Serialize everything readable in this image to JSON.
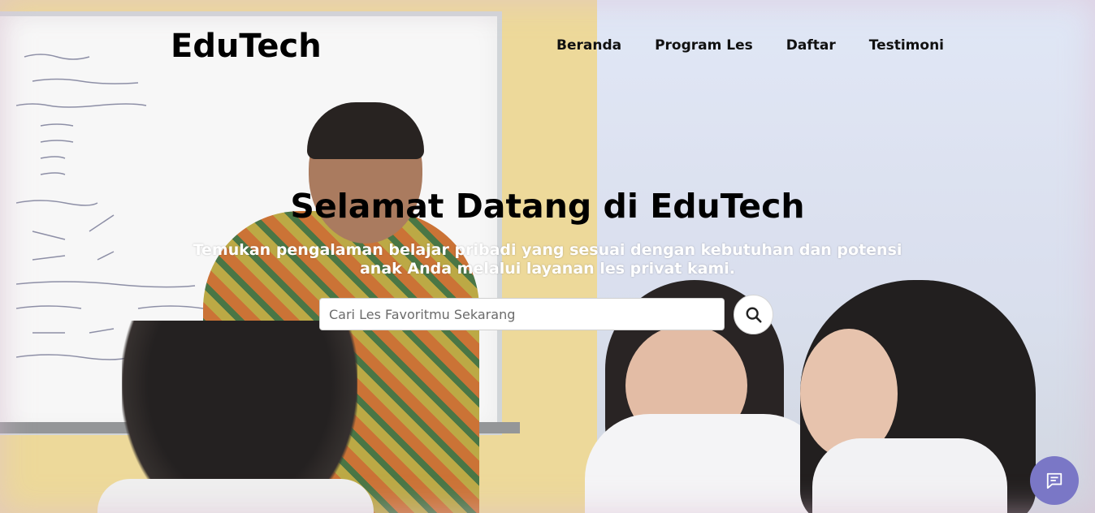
{
  "brand": {
    "name": "EduTech"
  },
  "nav": {
    "items": [
      {
        "label": "Beranda"
      },
      {
        "label": "Program Les"
      },
      {
        "label": "Daftar"
      },
      {
        "label": "Testimoni"
      }
    ]
  },
  "hero": {
    "title": "Selamat Datang di EduTech",
    "subtitle": "Temukan pengalaman belajar pribadi yang sesuai dengan kebutuhan dan potensi anak Anda melalui layanan les privat kami.",
    "background_image": "classroom-photo"
  },
  "search": {
    "placeholder": "Cari Les Favoritmu Sekarang",
    "value": "",
    "button_icon": "search-icon"
  },
  "chat": {
    "icon": "chat-icon",
    "color": "#7a77c6"
  }
}
